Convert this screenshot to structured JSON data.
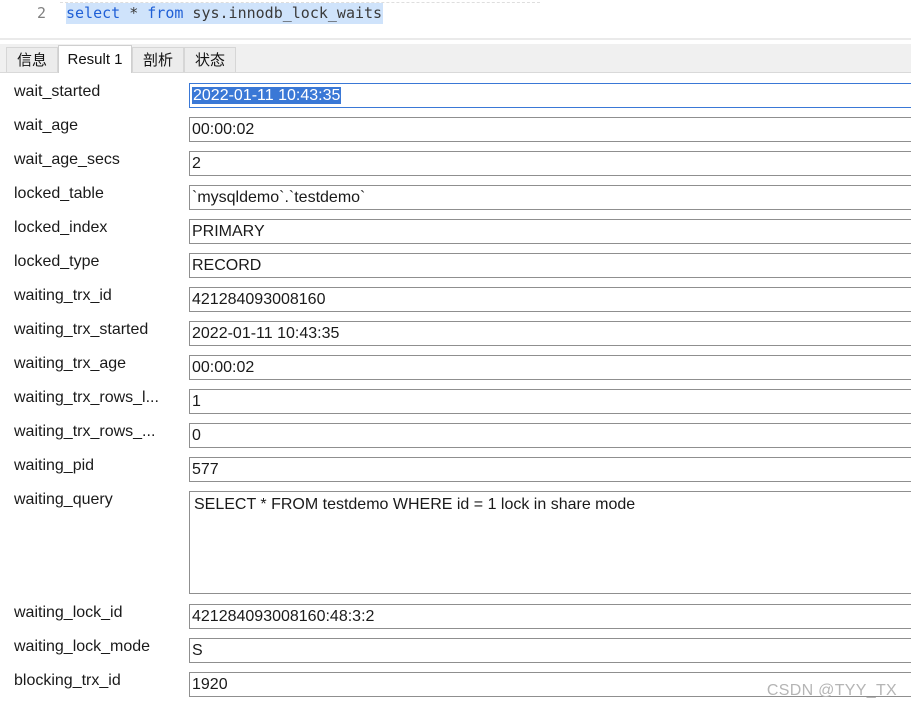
{
  "editor": {
    "line_number": "2",
    "kw_select": "select",
    "star": " * ",
    "kw_from": "from",
    "table": " sys.innodb_lock_waits"
  },
  "tabs": [
    {
      "label": "信息"
    },
    {
      "label": "Result 1"
    },
    {
      "label": "剖析"
    },
    {
      "label": "状态"
    }
  ],
  "fields": [
    {
      "label": "wait_started",
      "value": "2022-01-11 10:43:35"
    },
    {
      "label": "wait_age",
      "value": "00:00:02"
    },
    {
      "label": "wait_age_secs",
      "value": "2"
    },
    {
      "label": "locked_table",
      "value": "`mysqldemo`.`testdemo`"
    },
    {
      "label": "locked_index",
      "value": "PRIMARY"
    },
    {
      "label": "locked_type",
      "value": "RECORD"
    },
    {
      "label": "waiting_trx_id",
      "value": "421284093008160"
    },
    {
      "label": "waiting_trx_started",
      "value": "2022-01-11 10:43:35"
    },
    {
      "label": "waiting_trx_age",
      "value": "00:00:02"
    },
    {
      "label": "waiting_trx_rows_l...",
      "value": "1"
    },
    {
      "label": "waiting_trx_rows_...",
      "value": "0"
    },
    {
      "label": "waiting_pid",
      "value": "577"
    },
    {
      "label": "waiting_query",
      "value": "SELECT * FROM testdemo WHERE id = 1 lock in share mode"
    },
    {
      "label": "waiting_lock_id",
      "value": "421284093008160:48:3:2"
    },
    {
      "label": "waiting_lock_mode",
      "value": "S"
    },
    {
      "label": "blocking_trx_id",
      "value": "1920"
    }
  ],
  "watermark": "CSDN @TYY_TX"
}
